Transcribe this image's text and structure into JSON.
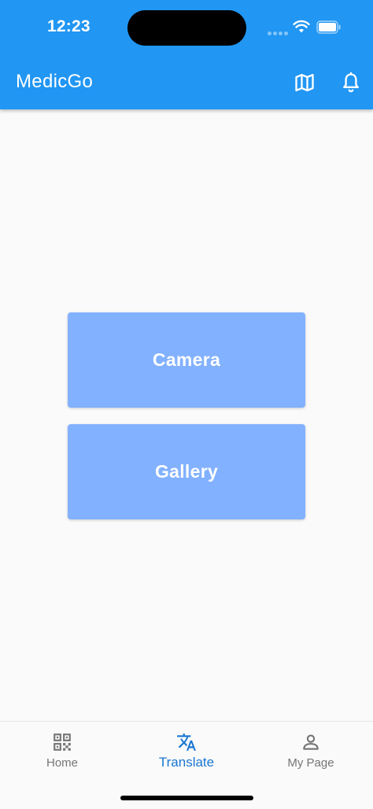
{
  "status_bar": {
    "time": "12:23",
    "icons": [
      "cellular-dots-icon",
      "wifi-icon",
      "battery-icon"
    ]
  },
  "app_bar": {
    "title": "MedicGo",
    "actions": [
      {
        "icon": "map-icon"
      },
      {
        "icon": "bell-icon"
      }
    ]
  },
  "main": {
    "camera_label": "Camera",
    "gallery_label": "Gallery"
  },
  "bottom_nav": {
    "items": [
      {
        "label": "Home",
        "icon": "qr-code-icon",
        "active": false
      },
      {
        "label": "Translate",
        "icon": "translate-icon",
        "active": true
      },
      {
        "label": "My Page",
        "icon": "person-icon",
        "active": false
      }
    ]
  },
  "colors": {
    "primary": "#2196f3",
    "button": "#82b1ff",
    "active_nav": "#1976d2",
    "inactive_nav": "#757575",
    "background": "#fafafa"
  }
}
